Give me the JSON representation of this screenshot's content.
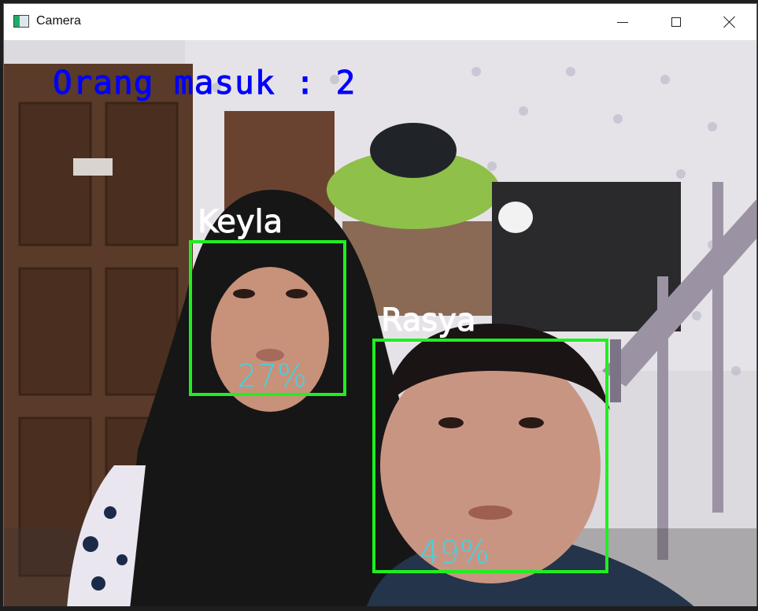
{
  "window": {
    "title": "Camera",
    "icon": "camera-app-icon",
    "controls": [
      "minimize-icon",
      "maximize-icon",
      "close-icon"
    ]
  },
  "overlay": {
    "counter_text": "Orang masuk : 2",
    "counter_color": "#0000ff",
    "box_color": "#1fef1f",
    "name_color": "#ffffff",
    "confidence_color": "#3fd3e7"
  },
  "faces": [
    {
      "name": "Keyla",
      "confidence": "27%"
    },
    {
      "name": "Rasya",
      "confidence": "49%"
    }
  ]
}
